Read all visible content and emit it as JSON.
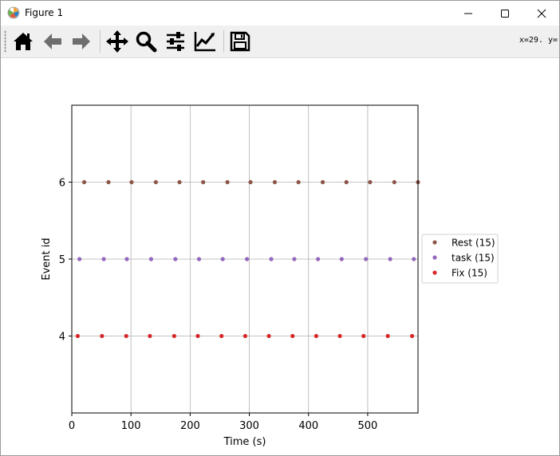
{
  "window": {
    "title": "Figure 1"
  },
  "toolbar": {
    "buttons": [
      {
        "name": "home-icon",
        "tooltip": "Home"
      },
      {
        "name": "back-arrow-icon",
        "tooltip": "Back"
      },
      {
        "name": "forward-arrow-icon",
        "tooltip": "Forward"
      },
      {
        "name": "pan-icon",
        "tooltip": "Pan"
      },
      {
        "name": "zoom-icon",
        "tooltip": "Zoom"
      },
      {
        "name": "subplots-config-icon",
        "tooltip": "Subplots"
      },
      {
        "name": "axes-edit-icon",
        "tooltip": "Customize"
      },
      {
        "name": "save-icon",
        "tooltip": "Save"
      }
    ],
    "coord_text": "x=29.  y="
  },
  "chart_data": {
    "type": "scatter",
    "title": "",
    "xlabel": "Time (s)",
    "ylabel": "Event id",
    "xlim": [
      0,
      585
    ],
    "ylim": [
      3,
      7
    ],
    "xticks": [
      0,
      100,
      200,
      300,
      400,
      500
    ],
    "yticks": [
      4,
      5,
      6
    ],
    "grid": "x-vertical and y-horizontal",
    "legend_placement": "right, outside axes",
    "series": [
      {
        "name": "Rest (15)",
        "color": "#8c564b",
        "y": 6,
        "x": [
          21,
          62,
          101,
          142,
          182,
          222,
          263,
          302,
          343,
          383,
          424,
          464,
          504,
          545,
          585
        ]
      },
      {
        "name": "task (15)",
        "color": "#9467bd",
        "y": 5,
        "x": [
          13,
          54,
          93,
          134,
          175,
          215,
          255,
          296,
          337,
          376,
          416,
          456,
          497,
          538,
          578
        ]
      },
      {
        "name": "Fix (15)",
        "color": "#d62728",
        "y": 4,
        "x": [
          10,
          51,
          92,
          132,
          173,
          213,
          253,
          293,
          333,
          373,
          413,
          453,
          493,
          534,
          575
        ]
      }
    ]
  }
}
